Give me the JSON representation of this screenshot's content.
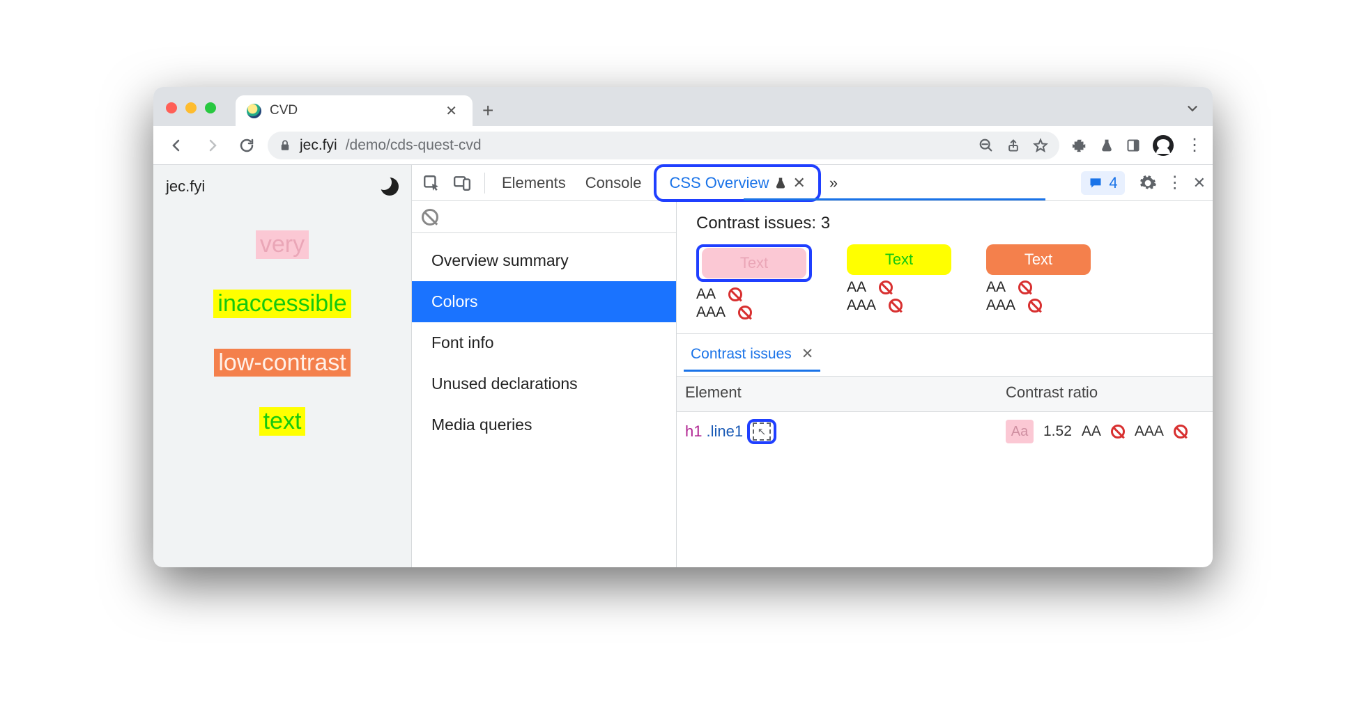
{
  "browser": {
    "tab_title": "CVD",
    "url_host": "jec.fyi",
    "url_path": "/demo/cds-quest-cvd"
  },
  "page": {
    "brand": "jec.fyi",
    "words": [
      "very",
      "inaccessible",
      "low-contrast",
      "text"
    ]
  },
  "devtools": {
    "tabs": [
      "Elements",
      "Console",
      "CSS Overview"
    ],
    "issues_count": "4",
    "overview_items": [
      "Overview summary",
      "Colors",
      "Font info",
      "Unused declarations",
      "Media queries"
    ],
    "overview_selected": "Colors",
    "contrast_label": "Contrast issues:",
    "contrast_count": "3",
    "swatch_label": "Text",
    "wcag_aa": "AA",
    "wcag_aaa": "AAA",
    "drawer_tab": "Contrast issues",
    "col_element": "Element",
    "col_ratio": "Contrast ratio",
    "row": {
      "tag": "h1",
      "cls": ".line1",
      "swatch_text": "Aa",
      "ratio": "1.52",
      "aa": "AA",
      "aaa": "AAA"
    }
  }
}
